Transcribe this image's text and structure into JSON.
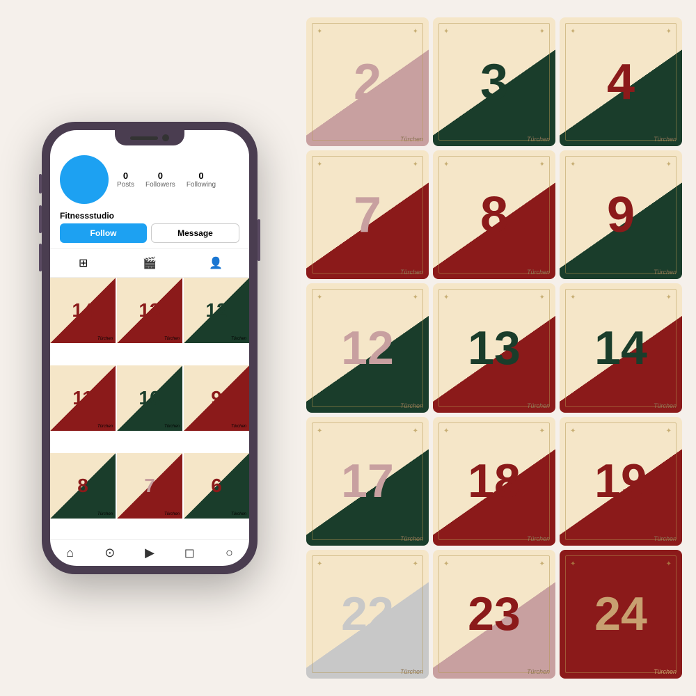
{
  "phone": {
    "profile": {
      "username": "Fitnessstudio",
      "stats": {
        "posts": {
          "label": "Posts",
          "value": "0"
        },
        "followers": {
          "label": "Followers",
          "value": "0"
        },
        "following": {
          "label": "Following",
          "value": "0"
        }
      },
      "follow_btn": "Follow",
      "message_btn": "Message"
    },
    "grid": [
      {
        "num": "14",
        "label": "Türchen",
        "bg": "phone-cell-1",
        "color": "#8b1a1a"
      },
      {
        "num": "13",
        "label": "Türchen",
        "bg": "phone-cell-2",
        "color": "#8b1a1a"
      },
      {
        "num": "12",
        "label": "Türchen",
        "bg": "phone-cell-3",
        "color": "#1a3d2b"
      },
      {
        "num": "11",
        "label": "Türchen",
        "bg": "phone-cell-4",
        "color": "#8b1a1a"
      },
      {
        "num": "10",
        "label": "Türchen",
        "bg": "phone-cell-5",
        "color": "#1a3d2b"
      },
      {
        "num": "9",
        "label": "Türchen",
        "bg": "phone-cell-6",
        "color": "#8b1a1a"
      },
      {
        "num": "8",
        "label": "Türchen",
        "bg": "phone-cell-7",
        "color": "#8b1a1a"
      },
      {
        "num": "7",
        "label": "Türchen",
        "bg": "phone-cell-8",
        "color": "#c8a0a0"
      },
      {
        "num": "6",
        "label": "Türchen",
        "bg": "phone-cell-9",
        "color": "#8b1a1a"
      }
    ],
    "nav_items": [
      "⌂",
      "🔍",
      "⬛",
      "🛍",
      "○"
    ]
  },
  "advent": {
    "cards": [
      {
        "num": "2",
        "label": "Türchen",
        "cls": "ac-2"
      },
      {
        "num": "3",
        "label": "Türchen",
        "cls": "ac-3"
      },
      {
        "num": "4",
        "label": "Türchen",
        "cls": "ac-4"
      },
      {
        "num": "7",
        "label": "Türchen",
        "cls": "ac-7"
      },
      {
        "num": "8",
        "label": "Türchen",
        "cls": "ac-8"
      },
      {
        "num": "9",
        "label": "Türchen",
        "cls": "ac-9"
      },
      {
        "num": "12",
        "label": "Türchen",
        "cls": "ac-12"
      },
      {
        "num": "13",
        "label": "Türchen",
        "cls": "ac-13"
      },
      {
        "num": "14",
        "label": "Türchen",
        "cls": "ac-14"
      },
      {
        "num": "17",
        "label": "Türchen",
        "cls": "ac-17"
      },
      {
        "num": "18",
        "label": "Türchen",
        "cls": "ac-18"
      },
      {
        "num": "19",
        "label": "Türchen",
        "cls": "ac-19"
      },
      {
        "num": "22",
        "label": "Türchen",
        "cls": "ac-22"
      },
      {
        "num": "23",
        "label": "Türchen",
        "cls": "ac-23"
      },
      {
        "num": "24",
        "label": "Türchen",
        "cls": "ac-24"
      }
    ]
  }
}
